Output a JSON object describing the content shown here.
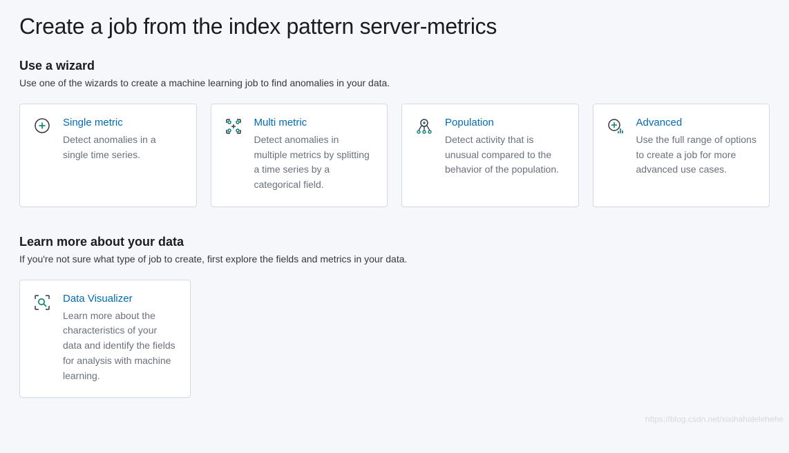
{
  "page_title": "Create a job from the index pattern server-metrics",
  "wizard": {
    "heading": "Use a wizard",
    "description": "Use one of the wizards to create a machine learning job to find anomalies in your data.",
    "cards": [
      {
        "icon": "single-metric-icon",
        "title": "Single metric",
        "desc": "Detect anomalies in a single time series."
      },
      {
        "icon": "multi-metric-icon",
        "title": "Multi metric",
        "desc": "Detect anomalies in multiple metrics by splitting a time series by a categorical field."
      },
      {
        "icon": "population-icon",
        "title": "Population",
        "desc": "Detect activity that is unusual compared to the behavior of the population."
      },
      {
        "icon": "advanced-icon",
        "title": "Advanced",
        "desc": "Use the full range of options to create a job for more advanced use cases."
      }
    ]
  },
  "learn": {
    "heading": "Learn more about your data",
    "description": "If you're not sure what type of job to create, first explore the fields and metrics in your data.",
    "card": {
      "icon": "data-visualizer-icon",
      "title": "Data Visualizer",
      "desc": "Learn more about the characteristics of your data and identify the fields for analysis with machine learning."
    }
  },
  "watermark": "https://blog.csdn.net/xixihahalelehehe"
}
